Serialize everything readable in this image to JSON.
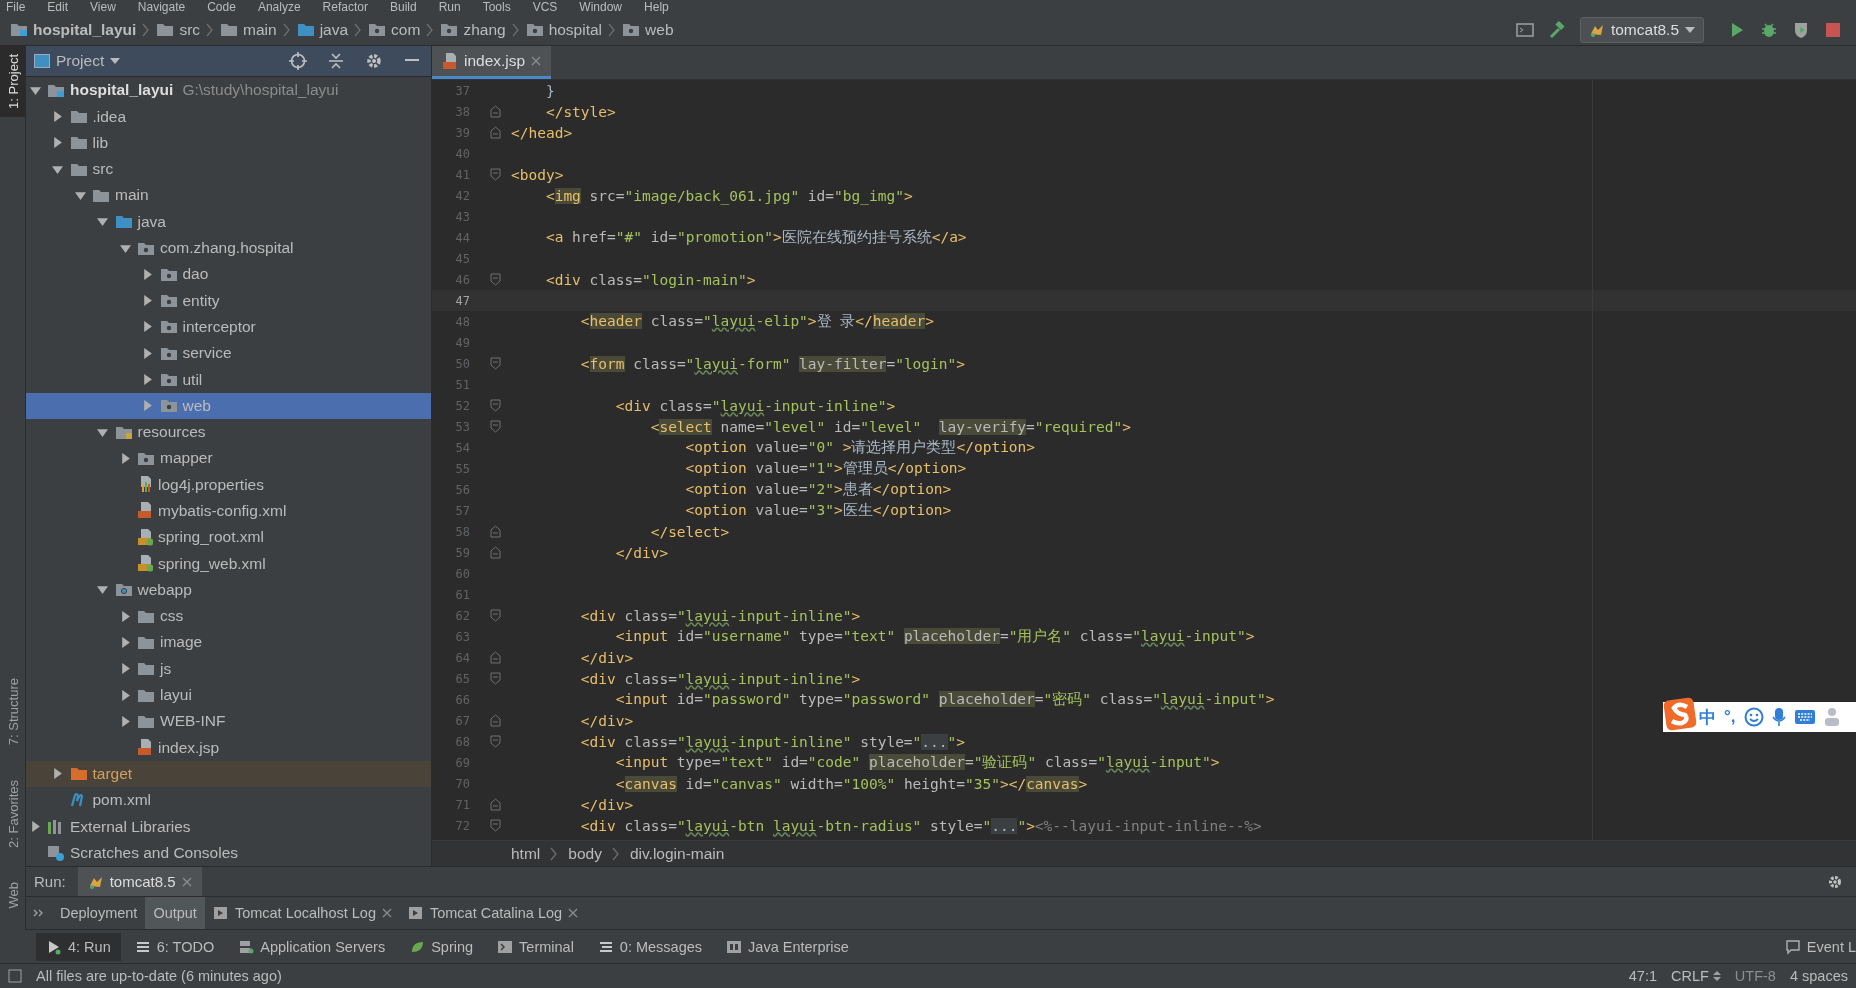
{
  "menu": [
    "File",
    "Edit",
    "View",
    "Navigate",
    "Code",
    "Analyze",
    "Refactor",
    "Build",
    "Run",
    "Tools",
    "VCS",
    "Window",
    "Help"
  ],
  "breadcrumb": [
    {
      "label": "hospital_layui",
      "kind": "module"
    },
    {
      "label": "src",
      "kind": "folder"
    },
    {
      "label": "main",
      "kind": "folder"
    },
    {
      "label": "java",
      "kind": "source"
    },
    {
      "label": "com",
      "kind": "package"
    },
    {
      "label": "zhang",
      "kind": "package"
    },
    {
      "label": "hospital",
      "kind": "package"
    },
    {
      "label": "web",
      "kind": "package"
    }
  ],
  "run_config": {
    "label": "tomcat8.5"
  },
  "left_strip": {
    "top": [
      {
        "label": "1: Project",
        "selected": true
      }
    ],
    "bottom": [
      {
        "label": "7: Structure",
        "selected": false
      },
      {
        "label": "2: Favorites",
        "selected": false
      },
      {
        "label": "Web",
        "selected": false
      }
    ]
  },
  "project_panel": {
    "title": "Project",
    "tree": [
      {
        "label": "hospital_layui",
        "path": "G:\\study\\hospital_layui",
        "kind": "module",
        "expanded": true,
        "selected": false,
        "children": [
          {
            "label": ".idea",
            "kind": "folder",
            "expanded": false,
            "selected": false
          },
          {
            "label": "lib",
            "kind": "folder",
            "expanded": false,
            "selected": false
          },
          {
            "label": "src",
            "kind": "folder",
            "expanded": true,
            "selected": false,
            "children": [
              {
                "label": "main",
                "kind": "folder",
                "expanded": true,
                "selected": false,
                "children": [
                  {
                    "label": "java",
                    "kind": "source",
                    "expanded": true,
                    "selected": false,
                    "children": [
                      {
                        "label": "com.zhang.hospital",
                        "kind": "package",
                        "expanded": true,
                        "selected": false,
                        "children": [
                          {
                            "label": "dao",
                            "kind": "package",
                            "expanded": false,
                            "selected": false
                          },
                          {
                            "label": "entity",
                            "kind": "package",
                            "expanded": false,
                            "selected": false
                          },
                          {
                            "label": "interceptor",
                            "kind": "package",
                            "expanded": false,
                            "selected": false
                          },
                          {
                            "label": "service",
                            "kind": "package",
                            "expanded": false,
                            "selected": false
                          },
                          {
                            "label": "util",
                            "kind": "package",
                            "expanded": false,
                            "selected": false
                          },
                          {
                            "label": "web",
                            "kind": "package",
                            "expanded": false,
                            "selected": true
                          }
                        ]
                      }
                    ]
                  },
                  {
                    "label": "resources",
                    "kind": "resources",
                    "expanded": true,
                    "selected": false,
                    "children": [
                      {
                        "label": "mapper",
                        "kind": "package",
                        "expanded": false,
                        "selected": false
                      },
                      {
                        "label": "log4j.properties",
                        "kind": "properties",
                        "selected": false
                      },
                      {
                        "label": "mybatis-config.xml",
                        "kind": "xml",
                        "selected": false
                      },
                      {
                        "label": "spring_root.xml",
                        "kind": "spring-xml",
                        "selected": false
                      },
                      {
                        "label": "spring_web.xml",
                        "kind": "spring-xml",
                        "selected": false
                      }
                    ]
                  },
                  {
                    "label": "webapp",
                    "kind": "web",
                    "expanded": true,
                    "selected": false,
                    "children": [
                      {
                        "label": "css",
                        "kind": "folder",
                        "expanded": false,
                        "selected": false
                      },
                      {
                        "label": "image",
                        "kind": "folder",
                        "expanded": false,
                        "selected": false
                      },
                      {
                        "label": "js",
                        "kind": "folder",
                        "expanded": false,
                        "selected": false
                      },
                      {
                        "label": "layui",
                        "kind": "folder",
                        "expanded": false,
                        "selected": false
                      },
                      {
                        "label": "WEB-INF",
                        "kind": "folder",
                        "expanded": false,
                        "selected": false
                      },
                      {
                        "label": "index.jsp",
                        "kind": "jsp",
                        "selected": false
                      }
                    ]
                  }
                ]
              }
            ]
          },
          {
            "label": "target",
            "kind": "excluded",
            "expanded": false,
            "selected": false
          },
          {
            "label": "pom.xml",
            "kind": "maven",
            "selected": false
          }
        ]
      },
      {
        "label": "External Libraries",
        "kind": "libraries",
        "expanded": false,
        "selected": false
      },
      {
        "label": "Scratches and Consoles",
        "kind": "scratches",
        "selected": false
      }
    ]
  },
  "editor": {
    "tabs": [
      {
        "label": "index.jsp",
        "selected": true
      }
    ],
    "lines": [
      {
        "number": "37",
        "current": false,
        "kind": "plain",
        "segments": [
          {
            "text": "    }",
            "kind": "text"
          }
        ]
      },
      {
        "number": "38",
        "current": false,
        "kind": "fold-end",
        "segments": [
          {
            "text": "    </style>",
            "kind": "tag"
          }
        ]
      },
      {
        "number": "39",
        "current": false,
        "kind": "fold-end",
        "segments": [
          {
            "text": "</head>",
            "kind": "tag"
          }
        ]
      },
      {
        "number": "40",
        "current": false,
        "kind": "plain"
      },
      {
        "number": "41",
        "current": false,
        "kind": "fold-start",
        "segments": [
          {
            "text": "<body>",
            "kind": "tag"
          }
        ]
      },
      {
        "number": "42",
        "current": false,
        "kind": "plain",
        "segments": [
          {
            "text": "    <",
            "kind": "tag"
          },
          {
            "text": "img",
            "kind": "tag-hl"
          },
          {
            "text": " src=",
            "kind": "attr"
          },
          {
            "text": "\"image/back_061.jpg\"",
            "kind": "value"
          },
          {
            "text": " id=",
            "kind": "attr"
          },
          {
            "text": "\"bg_img\"",
            "kind": "value"
          },
          {
            "text": ">",
            "kind": "tag"
          }
        ]
      },
      {
        "number": "43",
        "current": false,
        "kind": "plain"
      },
      {
        "number": "44",
        "current": false,
        "kind": "plain",
        "segments": [
          {
            "text": "    <a",
            "kind": "tag"
          },
          {
            "text": " href=",
            "kind": "attr"
          },
          {
            "text": "\"#\"",
            "kind": "value"
          },
          {
            "text": " id=",
            "kind": "attr"
          },
          {
            "text": "\"promotion\"",
            "kind": "value"
          },
          {
            "text": ">",
            "kind": "tag"
          },
          {
            "text": "医院在线预约挂号系统",
            "kind": "text"
          },
          {
            "text": "</a>",
            "kind": "tag"
          }
        ]
      },
      {
        "number": "45",
        "current": false,
        "kind": "plain"
      },
      {
        "number": "46",
        "current": false,
        "kind": "fold-start",
        "segments": [
          {
            "text": "    <div",
            "kind": "tag"
          },
          {
            "text": " class=",
            "kind": "attr"
          },
          {
            "text": "\"login-main\"",
            "kind": "value"
          },
          {
            "text": ">",
            "kind": "tag"
          }
        ]
      },
      {
        "number": "47",
        "current": true,
        "kind": "plain"
      },
      {
        "number": "48",
        "current": false,
        "kind": "plain",
        "segments": [
          {
            "text": "        <",
            "kind": "tag"
          },
          {
            "text": "header",
            "kind": "tag-hl"
          },
          {
            "text": " class=",
            "kind": "attr"
          },
          {
            "text": "\"",
            "kind": "value"
          },
          {
            "text": "layui",
            "kind": "typo"
          },
          {
            "text": "-elip\"",
            "kind": "value"
          },
          {
            "text": ">",
            "kind": "tag"
          },
          {
            "text": "登 录",
            "kind": "text"
          },
          {
            "text": "</",
            "kind": "tag"
          },
          {
            "text": "header",
            "kind": "tag-hl"
          },
          {
            "text": ">",
            "kind": "tag"
          }
        ]
      },
      {
        "number": "49",
        "current": false,
        "kind": "plain"
      },
      {
        "number": "50",
        "current": false,
        "kind": "fold-start",
        "segments": [
          {
            "text": "        <",
            "kind": "tag"
          },
          {
            "text": "form",
            "kind": "tag-hl"
          },
          {
            "text": " class=",
            "kind": "attr"
          },
          {
            "text": "\"",
            "kind": "value"
          },
          {
            "text": "layui",
            "kind": "typo"
          },
          {
            "text": "-form\" ",
            "kind": "value"
          },
          {
            "text": "lay-filter",
            "kind": "attr-hl"
          },
          {
            "text": "=",
            "kind": "attr"
          },
          {
            "text": "\"login\"",
            "kind": "value"
          },
          {
            "text": ">",
            "kind": "tag"
          }
        ]
      },
      {
        "number": "51",
        "current": false,
        "kind": "plain"
      },
      {
        "number": "52",
        "current": false,
        "kind": "fold-start",
        "segments": [
          {
            "text": "            <div",
            "kind": "tag"
          },
          {
            "text": " class=",
            "kind": "attr"
          },
          {
            "text": "\"",
            "kind": "value"
          },
          {
            "text": "layui",
            "kind": "typo"
          },
          {
            "text": "-input-inline\"",
            "kind": "value"
          },
          {
            "text": ">",
            "kind": "tag"
          }
        ]
      },
      {
        "number": "53",
        "current": false,
        "kind": "fold-start",
        "segments": [
          {
            "text": "                <",
            "kind": "tag"
          },
          {
            "text": "select",
            "kind": "tag-hl"
          },
          {
            "text": " name=",
            "kind": "attr"
          },
          {
            "text": "\"level\"",
            "kind": "value"
          },
          {
            "text": " id=",
            "kind": "attr"
          },
          {
            "text": "\"level\"  ",
            "kind": "value"
          },
          {
            "text": "lay-verify",
            "kind": "attr-hl"
          },
          {
            "text": "=",
            "kind": "attr"
          },
          {
            "text": "\"required\"",
            "kind": "value"
          },
          {
            "text": ">",
            "kind": "tag"
          }
        ]
      },
      {
        "number": "54",
        "current": false,
        "kind": "plain",
        "segments": [
          {
            "text": "                    <option",
            "kind": "tag"
          },
          {
            "text": " value=",
            "kind": "attr"
          },
          {
            "text": "\"0\"",
            "kind": "value"
          },
          {
            "text": " >",
            "kind": "tag"
          },
          {
            "text": "请选择用户类型",
            "kind": "text"
          },
          {
            "text": "</option>",
            "kind": "tag"
          }
        ]
      },
      {
        "number": "55",
        "current": false,
        "kind": "plain",
        "segments": [
          {
            "text": "                    <option",
            "kind": "tag"
          },
          {
            "text": " value=",
            "kind": "attr"
          },
          {
            "text": "\"1\"",
            "kind": "value"
          },
          {
            "text": ">",
            "kind": "tag"
          },
          {
            "text": "管理员",
            "kind": "text"
          },
          {
            "text": "</option>",
            "kind": "tag"
          }
        ]
      },
      {
        "number": "56",
        "current": false,
        "kind": "plain",
        "segments": [
          {
            "text": "                    <option",
            "kind": "tag"
          },
          {
            "text": " value=",
            "kind": "attr"
          },
          {
            "text": "\"2\"",
            "kind": "value"
          },
          {
            "text": ">",
            "kind": "tag"
          },
          {
            "text": "患者",
            "kind": "text"
          },
          {
            "text": "</option>",
            "kind": "tag"
          }
        ]
      },
      {
        "number": "57",
        "current": false,
        "kind": "plain",
        "segments": [
          {
            "text": "                    <option",
            "kind": "tag"
          },
          {
            "text": " value=",
            "kind": "attr"
          },
          {
            "text": "\"3\"",
            "kind": "value"
          },
          {
            "text": ">",
            "kind": "tag"
          },
          {
            "text": "医生",
            "kind": "text"
          },
          {
            "text": "</option>",
            "kind": "tag"
          }
        ]
      },
      {
        "number": "58",
        "current": false,
        "kind": "fold-end",
        "segments": [
          {
            "text": "                </select>",
            "kind": "tag"
          }
        ]
      },
      {
        "number": "59",
        "current": false,
        "kind": "fold-end",
        "segments": [
          {
            "text": "            </div>",
            "kind": "tag"
          }
        ]
      },
      {
        "number": "60",
        "current": false,
        "kind": "plain"
      },
      {
        "number": "61",
        "current": false,
        "kind": "plain"
      },
      {
        "number": "62",
        "current": false,
        "kind": "fold-start",
        "segments": [
          {
            "text": "        <div",
            "kind": "tag"
          },
          {
            "text": " class=",
            "kind": "attr"
          },
          {
            "text": "\"",
            "kind": "value"
          },
          {
            "text": "layui",
            "kind": "typo"
          },
          {
            "text": "-input-inline\"",
            "kind": "value"
          },
          {
            "text": ">",
            "kind": "tag"
          }
        ]
      },
      {
        "number": "63",
        "current": false,
        "kind": "plain",
        "segments": [
          {
            "text": "            <input",
            "kind": "tag"
          },
          {
            "text": " id=",
            "kind": "attr"
          },
          {
            "text": "\"username\"",
            "kind": "value"
          },
          {
            "text": " type=",
            "kind": "attr"
          },
          {
            "text": "\"text\" ",
            "kind": "value"
          },
          {
            "text": "placeholder",
            "kind": "attr-hl"
          },
          {
            "text": "=",
            "kind": "attr"
          },
          {
            "text": "\"用户名\"",
            "kind": "value"
          },
          {
            "text": " class=",
            "kind": "attr"
          },
          {
            "text": "\"",
            "kind": "value"
          },
          {
            "text": "layui",
            "kind": "typo"
          },
          {
            "text": "-input\"",
            "kind": "value"
          },
          {
            "text": ">",
            "kind": "tag"
          }
        ]
      },
      {
        "number": "64",
        "current": false,
        "kind": "fold-end",
        "segments": [
          {
            "text": "        </div>",
            "kind": "tag"
          }
        ]
      },
      {
        "number": "65",
        "current": false,
        "kind": "fold-start",
        "segments": [
          {
            "text": "        <div",
            "kind": "tag"
          },
          {
            "text": " class=",
            "kind": "attr"
          },
          {
            "text": "\"",
            "kind": "value"
          },
          {
            "text": "layui",
            "kind": "typo"
          },
          {
            "text": "-input-inline\"",
            "kind": "value"
          },
          {
            "text": ">",
            "kind": "tag"
          }
        ]
      },
      {
        "number": "66",
        "current": false,
        "kind": "plain",
        "segments": [
          {
            "text": "            <input",
            "kind": "tag"
          },
          {
            "text": " id=",
            "kind": "attr"
          },
          {
            "text": "\"password\"",
            "kind": "value"
          },
          {
            "text": " type=",
            "kind": "attr"
          },
          {
            "text": "\"password\" ",
            "kind": "value"
          },
          {
            "text": "placeholder",
            "kind": "attr-hl"
          },
          {
            "text": "=",
            "kind": "attr"
          },
          {
            "text": "\"密码\"",
            "kind": "value"
          },
          {
            "text": " class=",
            "kind": "attr"
          },
          {
            "text": "\"",
            "kind": "value"
          },
          {
            "text": "layui",
            "kind": "typo"
          },
          {
            "text": "-input\"",
            "kind": "value"
          },
          {
            "text": ">",
            "kind": "tag"
          }
        ]
      },
      {
        "number": "67",
        "current": false,
        "kind": "fold-end",
        "segments": [
          {
            "text": "        </div>",
            "kind": "tag"
          }
        ]
      },
      {
        "number": "68",
        "current": false,
        "kind": "fold-start",
        "segments": [
          {
            "text": "        <div",
            "kind": "tag"
          },
          {
            "text": " class=",
            "kind": "attr"
          },
          {
            "text": "\"",
            "kind": "value"
          },
          {
            "text": "layui",
            "kind": "typo"
          },
          {
            "text": "-input-inline\"",
            "kind": "value"
          },
          {
            "text": " style=",
            "kind": "attr"
          },
          {
            "text": "\"",
            "kind": "value"
          },
          {
            "text": "...",
            "kind": "folded"
          },
          {
            "text": "\"",
            "kind": "value"
          },
          {
            "text": ">",
            "kind": "tag"
          }
        ]
      },
      {
        "number": "69",
        "current": false,
        "kind": "plain",
        "segments": [
          {
            "text": "            <input",
            "kind": "tag"
          },
          {
            "text": " type=",
            "kind": "attr"
          },
          {
            "text": "\"text\"",
            "kind": "value"
          },
          {
            "text": " id=",
            "kind": "attr"
          },
          {
            "text": "\"code\" ",
            "kind": "value"
          },
          {
            "text": "placeholder",
            "kind": "attr-hl"
          },
          {
            "text": "=",
            "kind": "attr"
          },
          {
            "text": "\"验证码\"",
            "kind": "value"
          },
          {
            "text": " class=",
            "kind": "attr"
          },
          {
            "text": "\"",
            "kind": "value"
          },
          {
            "text": "layui",
            "kind": "typo"
          },
          {
            "text": "-input\"",
            "kind": "value"
          },
          {
            "text": ">",
            "kind": "tag"
          }
        ]
      },
      {
        "number": "70",
        "current": false,
        "kind": "plain",
        "segments": [
          {
            "text": "            <",
            "kind": "tag"
          },
          {
            "text": "canvas",
            "kind": "tag-hl"
          },
          {
            "text": " id=",
            "kind": "attr"
          },
          {
            "text": "\"canvas\"",
            "kind": "value"
          },
          {
            "text": " width=",
            "kind": "attr"
          },
          {
            "text": "\"100%\"",
            "kind": "value"
          },
          {
            "text": " height=",
            "kind": "attr"
          },
          {
            "text": "\"35\"",
            "kind": "value"
          },
          {
            "text": ">",
            "kind": "tag"
          },
          {
            "text": "</",
            "kind": "tag"
          },
          {
            "text": "canvas",
            "kind": "tag-hl"
          },
          {
            "text": ">",
            "kind": "tag"
          }
        ]
      },
      {
        "number": "71",
        "current": false,
        "kind": "fold-end",
        "segments": [
          {
            "text": "        </div>",
            "kind": "tag"
          }
        ]
      },
      {
        "number": "72",
        "current": false,
        "kind": "fold-start",
        "segments": [
          {
            "text": "        <div",
            "kind": "tag"
          },
          {
            "text": " class=",
            "kind": "attr"
          },
          {
            "text": "\"",
            "kind": "value"
          },
          {
            "text": "layui",
            "kind": "typo"
          },
          {
            "text": "-btn ",
            "kind": "value"
          },
          {
            "text": "layui",
            "kind": "typo"
          },
          {
            "text": "-btn-radius\"",
            "kind": "value"
          },
          {
            "text": " style=",
            "kind": "attr"
          },
          {
            "text": "\"",
            "kind": "value"
          },
          {
            "text": "...",
            "kind": "folded"
          },
          {
            "text": "\"",
            "kind": "value"
          },
          {
            "text": ">",
            "kind": "tag"
          },
          {
            "text": "<%--layui-input-inline--%>",
            "kind": "comment"
          }
        ]
      }
    ],
    "breadcrumb": [
      "html",
      "body",
      "div.login-main"
    ]
  },
  "ime_bar": {
    "texts": [
      "中",
      "°,"
    ]
  },
  "run_panel": {
    "label": "Run:",
    "tabs": [
      {
        "label": "tomcat8.5",
        "selected": true
      }
    ],
    "subtabs": [
      {
        "label": "Deployment",
        "selected": false,
        "kind": "plain"
      },
      {
        "label": "Output",
        "selected": true,
        "kind": "plain"
      },
      {
        "label": "Tomcat Localhost Log",
        "selected": false,
        "kind": "log"
      },
      {
        "label": "Tomcat Catalina Log",
        "selected": false,
        "kind": "log"
      }
    ]
  },
  "tool_windows": [
    {
      "label": "4: Run",
      "kind": "run",
      "selected": true
    },
    {
      "label": "6: TODO",
      "kind": "todo",
      "selected": false
    },
    {
      "label": "Application Servers",
      "kind": "servers",
      "selected": false
    },
    {
      "label": "Spring",
      "kind": "spring",
      "selected": false
    },
    {
      "label": "Terminal",
      "kind": "terminal",
      "selected": false
    },
    {
      "label": "0: Messages",
      "kind": "messages",
      "selected": false
    },
    {
      "label": "Java Enterprise",
      "kind": "javaee",
      "selected": false
    }
  ],
  "event_log": "Event L",
  "status_bar": {
    "message": "All files are up-to-date (6 minutes ago)",
    "position": "47:1",
    "line_separator": "CRLF",
    "encoding": "UTF-8",
    "indent": "4 spaces"
  }
}
